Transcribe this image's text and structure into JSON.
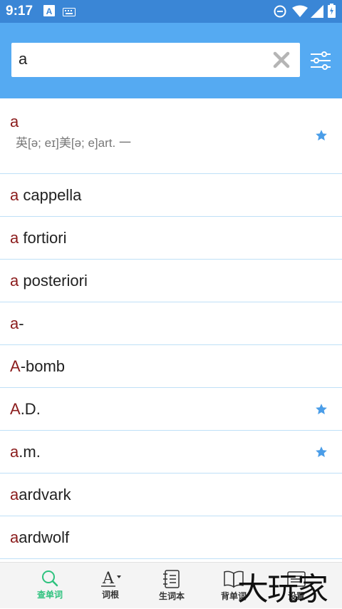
{
  "status_bar": {
    "time": "9:17",
    "left_icons": [
      "keyboard-a-icon",
      "keyboard-icon"
    ],
    "right_icons": [
      "dnd-icon",
      "wifi-icon",
      "signal-icon",
      "battery-icon"
    ]
  },
  "search": {
    "query": "a",
    "clear_icon": "close-icon",
    "filter_icon": "filter-sliders-icon"
  },
  "colors": {
    "status_bar": "#3a86d6",
    "app_bar": "#55aaf2",
    "highlight": "#8b1c1c",
    "star": "#4a9de8",
    "nav_active": "#2ec27e",
    "divider": "#bfe0f7"
  },
  "results": [
    {
      "match": "a",
      "rest": "",
      "definition": "英[ə; eɪ]美[ə; e]art. 一",
      "starred": true
    },
    {
      "match": "a",
      "rest": " cappella",
      "starred": false
    },
    {
      "match": "a",
      "rest": " fortiori",
      "starred": false
    },
    {
      "match": "a",
      "rest": " posteriori",
      "starred": false
    },
    {
      "match": "a",
      "rest": "-",
      "starred": false
    },
    {
      "match": "A",
      "rest": "-bomb",
      "starred": false
    },
    {
      "match": "A",
      "rest": ".D.",
      "starred": true
    },
    {
      "match": "a",
      "rest": ".m.",
      "starred": true
    },
    {
      "match": "a",
      "rest": "ardvark",
      "starred": false
    },
    {
      "match": "a",
      "rest": "ardwolf",
      "starred": false
    }
  ],
  "bottom_nav": {
    "items": [
      {
        "label": "查单词",
        "icon": "search-icon",
        "active": true
      },
      {
        "label": "词根",
        "icon": "letter-a-icon",
        "active": false
      },
      {
        "label": "生词本",
        "icon": "notebook-icon",
        "active": false
      },
      {
        "label": "背单词",
        "icon": "book-open-icon",
        "active": false
      },
      {
        "label": "设置",
        "icon": "settings-icon",
        "active": false
      }
    ]
  },
  "watermark": "大玩家"
}
